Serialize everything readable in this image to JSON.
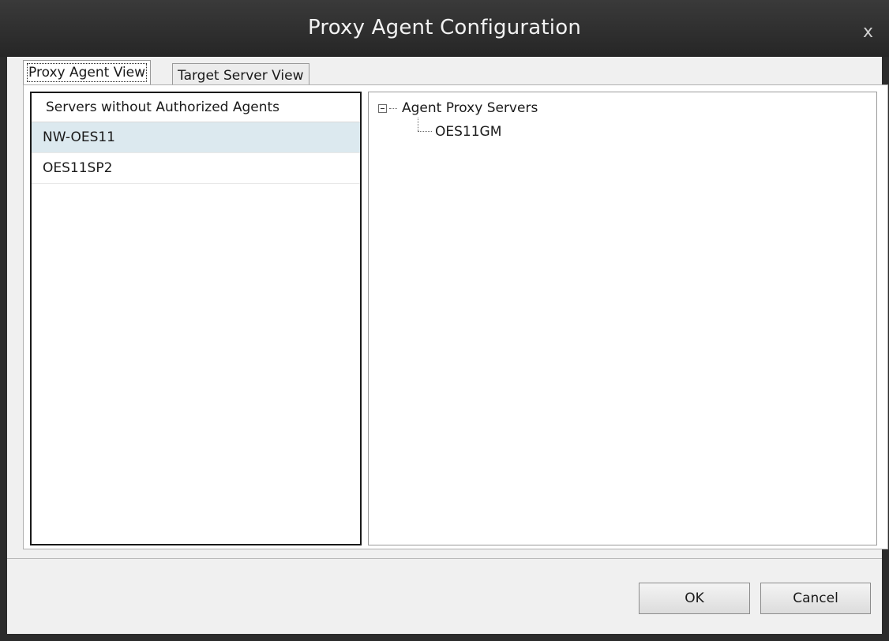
{
  "window": {
    "title": "Proxy Agent Configuration",
    "close_glyph": "x"
  },
  "tabs": [
    {
      "label": "Proxy Agent View",
      "active": true
    },
    {
      "label": "Target Server View",
      "active": false
    }
  ],
  "servers_list": {
    "header": "Servers without Authorized Agents",
    "items": [
      {
        "label": "NW-OES11",
        "selected": true
      },
      {
        "label": "OES11SP2",
        "selected": false
      }
    ]
  },
  "tree": {
    "root_label": "Agent Proxy Servers",
    "root_expanded": true,
    "children": [
      {
        "label": "OES11GM"
      }
    ]
  },
  "buttons": {
    "ok": "OK",
    "cancel": "Cancel"
  },
  "colors": {
    "titlebar": "#2b2b2b",
    "client_bg": "#f0f0f0",
    "selected_row": "#dce9ef"
  }
}
